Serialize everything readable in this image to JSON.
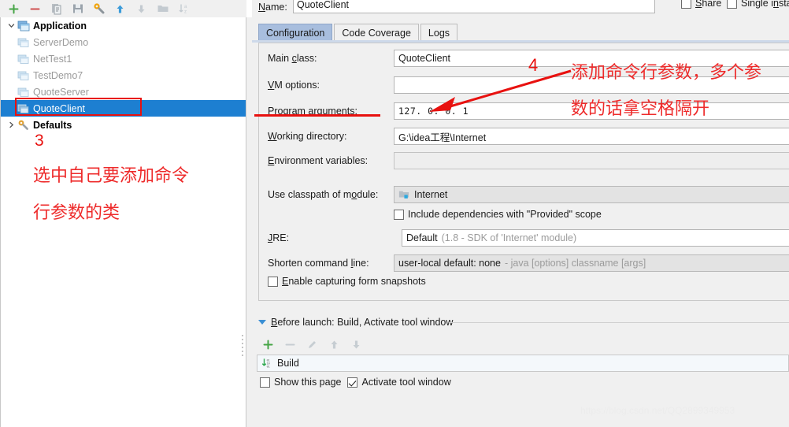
{
  "left_toolbar": {
    "buttons": [
      {
        "name": "add-icon",
        "glyph": "plus"
      },
      {
        "name": "remove-icon",
        "glyph": "minus"
      },
      {
        "name": "copy-icon",
        "glyph": "copy"
      },
      {
        "name": "save-icon",
        "glyph": "save"
      },
      {
        "name": "settings-wrench-icon",
        "glyph": "wrench"
      },
      {
        "name": "move-up-icon",
        "glyph": "arrow-up"
      },
      {
        "name": "move-down-icon",
        "glyph": "arrow-down"
      },
      {
        "name": "folder-icon",
        "glyph": "folder"
      },
      {
        "name": "sort-alphabetically-icon",
        "glyph": "sort-az"
      }
    ]
  },
  "tree": {
    "nodes": [
      {
        "label": "Application",
        "level": 0,
        "expanded": true,
        "style": "bold",
        "icon": "application-icon"
      },
      {
        "label": "ServerDemo",
        "level": 1,
        "style": "dim",
        "icon": "run-config-icon"
      },
      {
        "label": "NetTest1",
        "level": 1,
        "style": "dim",
        "icon": "run-config-icon"
      },
      {
        "label": "TestDemo7",
        "level": 1,
        "style": "dim",
        "icon": "run-config-icon"
      },
      {
        "label": "QuoteServer",
        "level": 1,
        "style": "dim",
        "icon": "run-config-icon"
      },
      {
        "label": "QuoteClient",
        "level": 1,
        "style": "selected",
        "icon": "run-config-icon"
      },
      {
        "label": "Defaults",
        "level": 0,
        "expanded": false,
        "style": "bold",
        "icon": "defaults-wrench-icon"
      }
    ]
  },
  "annotations": {
    "step3_number": "3",
    "step3_line1": "选中自己要添加命令",
    "step3_line2": "行参数的类",
    "step4_number": "4",
    "step4_line1": "添加命令行参数，多个参",
    "step4_line2": "数的话拿空格隔开",
    "color": "#ee2b2b"
  },
  "header": {
    "name_label": "Name:",
    "name_value": "QuoteClient",
    "share_label": "Share",
    "share_checked": false,
    "single_instance_label": "Single insta",
    "single_instance_checked": false
  },
  "tabs": [
    {
      "label": "Configuration",
      "active": true
    },
    {
      "label": "Code Coverage",
      "active": false
    },
    {
      "label": "Logs",
      "active": false
    }
  ],
  "form": {
    "main_class": {
      "label": "Main class:",
      "value": "QuoteClient"
    },
    "vm_options": {
      "label": "VM options:",
      "value": ""
    },
    "program_arguments": {
      "label": "Program arguments:",
      "value": "127. 0. 0. 1"
    },
    "working_directory": {
      "label": "Working directory:",
      "value": "G:\\idea工程\\Internet"
    },
    "environment_variables": {
      "label": "Environment variables:",
      "value": ""
    },
    "use_classpath_of_module": {
      "label": "Use classpath of module:",
      "value": "Internet"
    },
    "include_provided": {
      "label": "Include dependencies with \"Provided\" scope",
      "checked": false
    },
    "jre": {
      "label": "JRE:",
      "value": "Default",
      "hint": "(1.8 - SDK of 'Internet' module)"
    },
    "shorten_command_line": {
      "label": "Shorten command line:",
      "value": "user-local default: none",
      "hint": "- java [options] classname [args]"
    },
    "enable_form_snapshots": {
      "label": "Enable capturing form snapshots",
      "checked": false
    }
  },
  "before_launch": {
    "title": "Before launch: Build, Activate tool window",
    "toolbar": [
      {
        "name": "add-task-icon",
        "glyph": "plus"
      },
      {
        "name": "remove-task-icon",
        "glyph": "minus"
      },
      {
        "name": "edit-task-icon",
        "glyph": "pencil"
      },
      {
        "name": "move-task-up-icon",
        "glyph": "arrow-up"
      },
      {
        "name": "move-task-down-icon",
        "glyph": "arrow-down"
      }
    ],
    "tasks": [
      {
        "label": "Build",
        "icon": "build-icon"
      }
    ],
    "show_this_page": {
      "label": "Show this page",
      "checked": false
    },
    "activate_tool_window": {
      "label": "Activate tool window",
      "checked": true
    }
  },
  "watermark": "https://blog.csdn.net/QQ2899349953"
}
